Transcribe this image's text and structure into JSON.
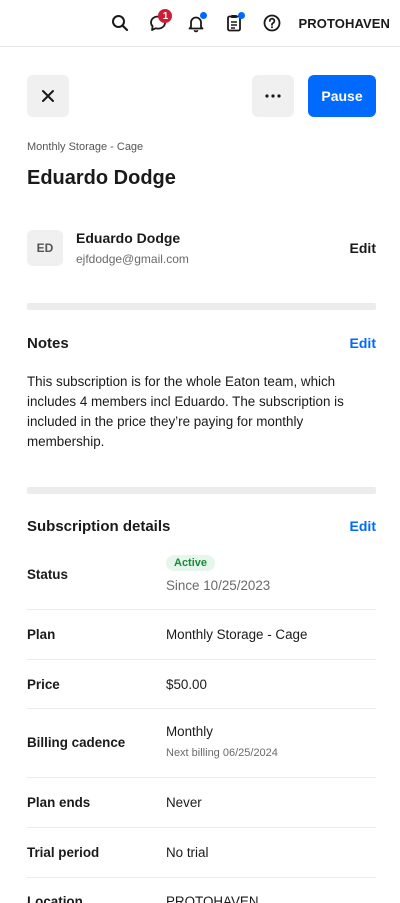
{
  "topbar": {
    "search_icon": "search-icon",
    "messages_icon": "chat-bubble-icon",
    "messages_badge": "1",
    "notifications_icon": "bell-icon",
    "tasks_icon": "clipboard-icon",
    "help_icon": "help-circle-icon",
    "org_name": "PROTOHAVEN",
    "badge_color": "#cc1f36",
    "dot_color": "#006aff"
  },
  "actions": {
    "close_icon": "close-icon",
    "more_icon": "more-horizontal-icon",
    "pause_label": "Pause",
    "accent": "#006aff"
  },
  "header": {
    "subtitle": "Monthly Storage - Cage",
    "title": "Eduardo Dodge"
  },
  "customer": {
    "initials": "ED",
    "name": "Eduardo Dodge",
    "email": "ejfdodge@gmail.com",
    "edit_label": "Edit"
  },
  "notes": {
    "title": "Notes",
    "edit_label": "Edit",
    "body": "This subscription is for the whole Eaton team, which includes 4 members incl Eduardo. The subscription is included in the price they’re paying for monthly membership."
  },
  "details": {
    "title": "Subscription details",
    "edit_label": "Edit",
    "status": {
      "label": "Status",
      "badge": "Active",
      "since": "Since 10/25/2023",
      "badge_color": "#1a8a3a"
    },
    "plan": {
      "label": "Plan",
      "value": "Monthly Storage - Cage"
    },
    "price": {
      "label": "Price",
      "value": "$50.00"
    },
    "billing": {
      "label": "Billing cadence",
      "value": "Monthly",
      "next": "Next billing 06/25/2024"
    },
    "plan_ends": {
      "label": "Plan ends",
      "value": "Never"
    },
    "trial": {
      "label": "Trial period",
      "value": "No trial"
    },
    "location": {
      "label": "Location",
      "value": "PROTOHAVEN"
    }
  }
}
